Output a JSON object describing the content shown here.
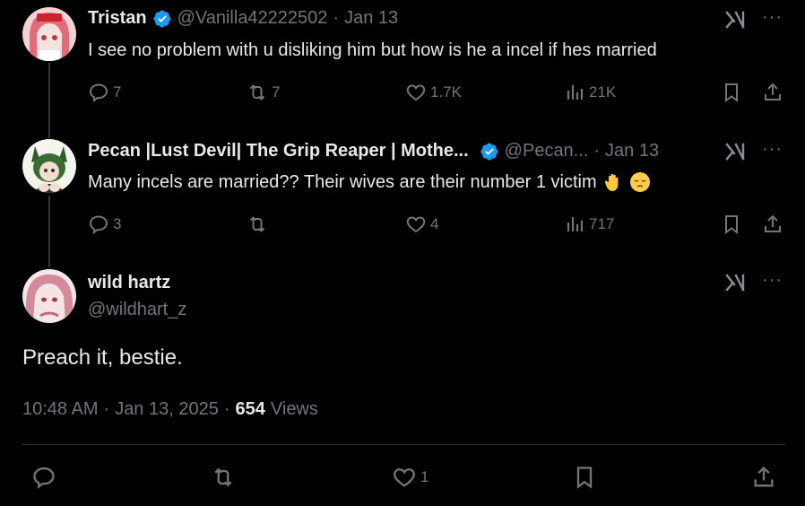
{
  "tweets": [
    {
      "name": "Tristan",
      "handle": "@Vanilla42222502",
      "sep": "·",
      "date": "Jan 13",
      "text": "I see no problem with u disliking him but how is he a incel if hes married",
      "replies": "7",
      "retweets": "7",
      "likes": "1.7K",
      "views": "21K"
    },
    {
      "name": "Pecan |Lust Devil| The Grip Reaper | Mothe...",
      "handle": "@Pecan...",
      "sep": "·",
      "date": "Jan 13",
      "text": "Many incels are married?? Their wives are their number 1 victim",
      "replies": "3",
      "retweets": "",
      "likes": "4",
      "views": "717"
    }
  ],
  "main": {
    "name": "wild hartz",
    "handle": "@wildhart_z",
    "text": "Preach it, bestie.",
    "time": "10:48 AM",
    "sep1": "·",
    "date": "Jan 13, 2025",
    "sep2": "·",
    "views_count": "654",
    "views_label": "Views",
    "likes": "1"
  },
  "more_label": "···",
  "colors": {
    "background": "#000000",
    "text": "#e7e9ea",
    "muted": "#71767b",
    "verified": "#1d9bf0",
    "divider": "#2f3336"
  },
  "icons": [
    "reply-icon",
    "retweet-icon",
    "like-icon",
    "views-icon",
    "bookmark-icon",
    "share-icon",
    "grok-icon",
    "more-icon",
    "verified-icon"
  ]
}
